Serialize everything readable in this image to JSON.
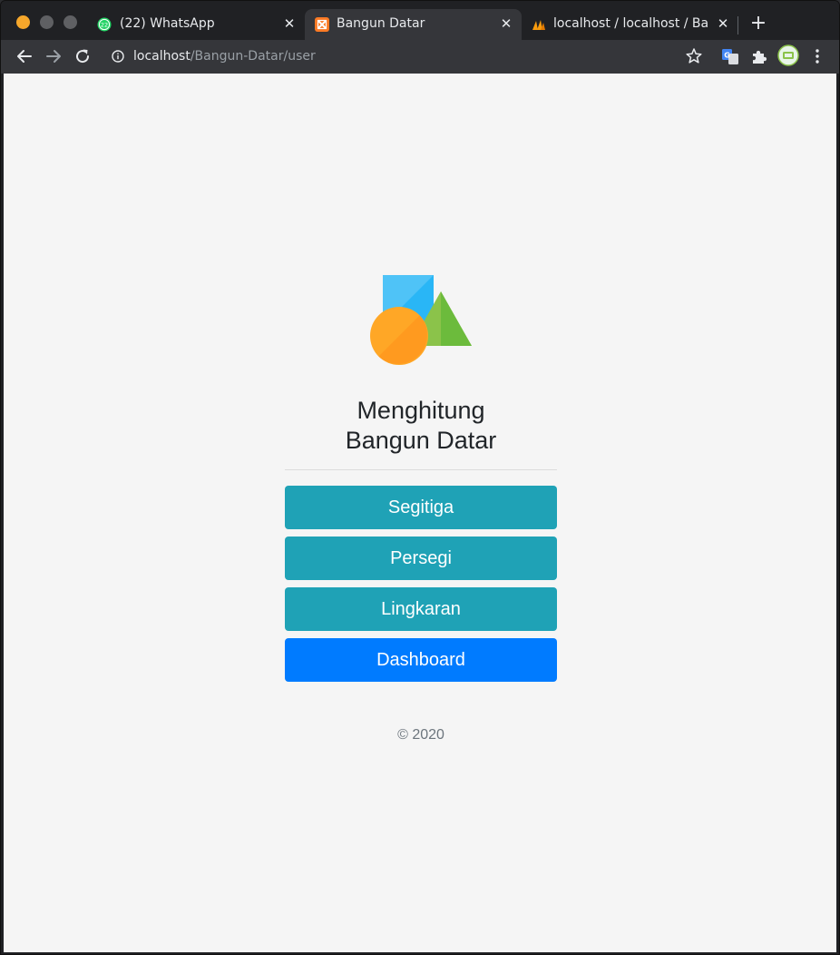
{
  "browser": {
    "tabs": [
      {
        "title": "(22) WhatsApp",
        "badge": "22",
        "icon": "whatsapp-icon"
      },
      {
        "title": "Bangun Datar",
        "icon": "xampp-icon",
        "active": true
      },
      {
        "title": "localhost / localhost / Bangun",
        "icon": "phpmyadmin-icon"
      }
    ],
    "close_glyph": "✕",
    "new_tab_glyph": "+",
    "url": {
      "host": "localhost",
      "path": "/Bangun-Datar/user"
    },
    "toolbar_icons": [
      "back-arrow-icon",
      "forward-arrow-icon",
      "reload-icon",
      "info-icon",
      "star-icon",
      "translate-icon",
      "extensions-icon",
      "profile-avatar",
      "menu-dots-icon"
    ]
  },
  "page": {
    "title_line1": "Menghitung",
    "title_line2": "Bangun Datar",
    "menu": [
      {
        "label": "Segitiga",
        "style": "info"
      },
      {
        "label": "Persegi",
        "style": "info"
      },
      {
        "label": "Lingkaran",
        "style": "info"
      },
      {
        "label": "Dashboard",
        "style": "primary"
      }
    ],
    "footer": "© 2020"
  },
  "colors": {
    "info_button": "#1fa2b6",
    "primary_button": "#007bff",
    "page_background": "#f5f5f5",
    "logo_square": "#4fc3f7",
    "logo_triangle": "#8bc34a",
    "logo_circle": "#ffa726"
  }
}
